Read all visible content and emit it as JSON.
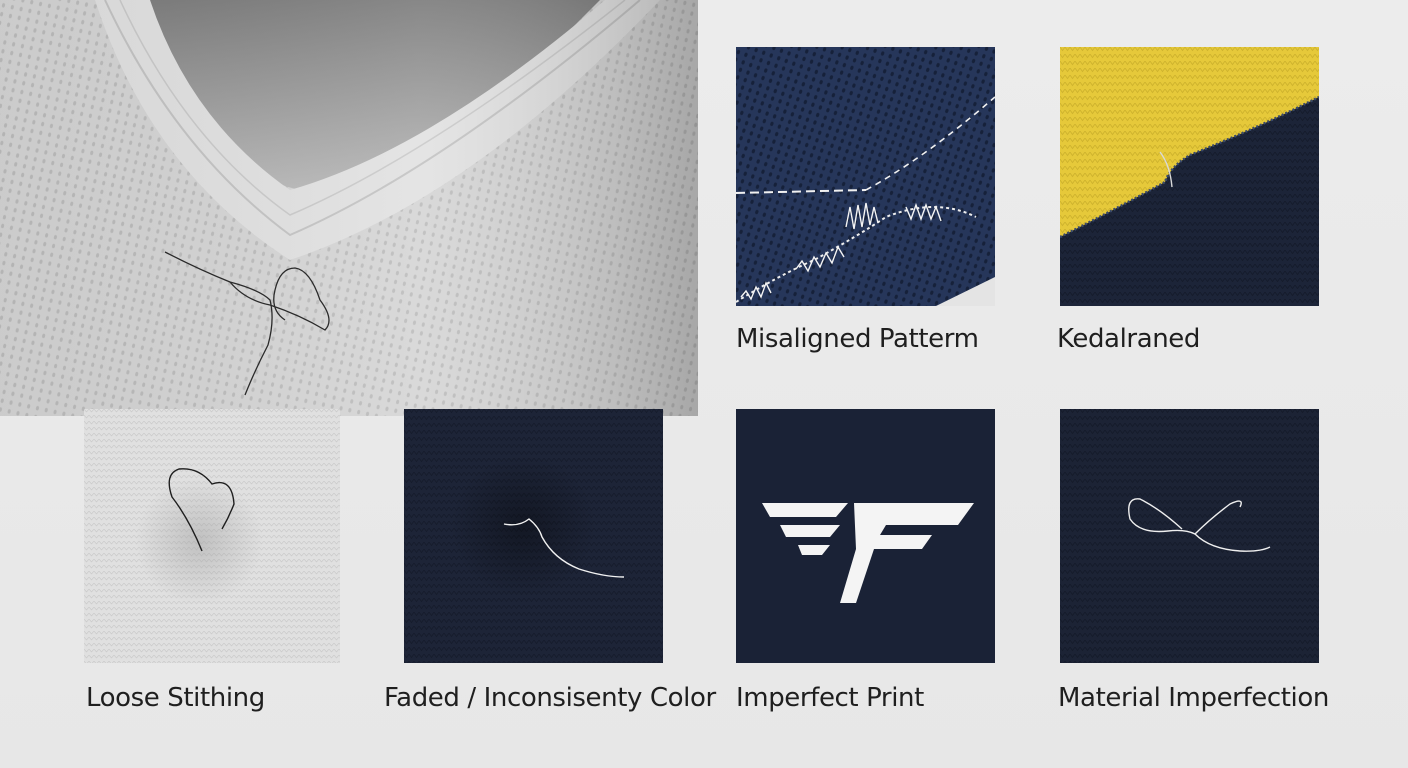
{
  "panels": [
    {
      "id": "hero",
      "caption": ""
    },
    {
      "id": "misaligned",
      "caption": "Misaligned Patterm"
    },
    {
      "id": "kedalraned",
      "caption": "Kedalraned"
    },
    {
      "id": "loose",
      "caption": "Loose Stithing"
    },
    {
      "id": "faded",
      "caption": "Faded / Inconsisenty Color"
    },
    {
      "id": "print",
      "caption": "Imperfect Print"
    },
    {
      "id": "material",
      "caption": "Material Imperfection"
    }
  ],
  "colors": {
    "navy": "#1d2a44",
    "navy_dark": "#1a2236",
    "yellow": "#e6c93a",
    "light_fabric": "#d8d8d8",
    "background": "#ebebeb",
    "thread_white": "#f4f4f4",
    "thread_dark": "#2a2a2a"
  },
  "print_logo": {
    "glyph": "F",
    "style": "winged-letter"
  }
}
